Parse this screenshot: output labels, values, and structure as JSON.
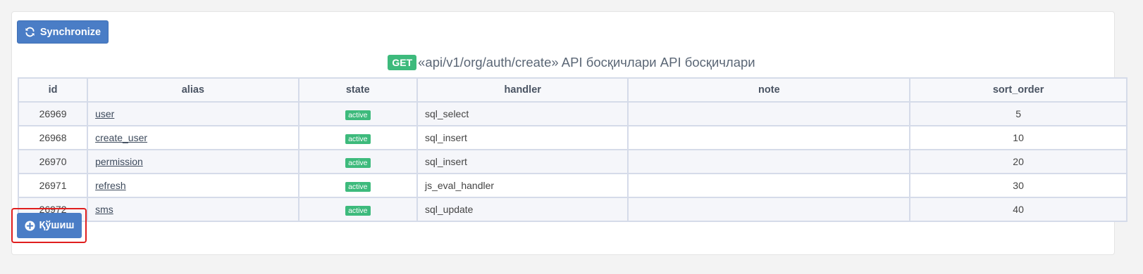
{
  "toolbar": {
    "sync_label": "Synchronize",
    "sync_icon": "refresh-icon"
  },
  "header": {
    "method_badge": "GET",
    "title": "«api/v1/org/auth/create» API босқичлари API босқичлари"
  },
  "table": {
    "columns": [
      "id",
      "alias",
      "state",
      "handler",
      "note",
      "sort_order"
    ],
    "rows": [
      {
        "id": "26969",
        "alias": "user",
        "state": "active",
        "handler": "sql_select",
        "note": "",
        "sort_order": "5"
      },
      {
        "id": "26968",
        "alias": "create_user",
        "state": "active",
        "handler": "sql_insert",
        "note": "",
        "sort_order": "10"
      },
      {
        "id": "26970",
        "alias": "permission",
        "state": "active",
        "handler": "sql_insert",
        "note": "",
        "sort_order": "20"
      },
      {
        "id": "26971",
        "alias": "refresh",
        "state": "active",
        "handler": "js_eval_handler",
        "note": "",
        "sort_order": "30"
      },
      {
        "id": "26972",
        "alias": "sms",
        "state": "active",
        "handler": "sql_update",
        "note": "",
        "sort_order": "40"
      }
    ]
  },
  "footer": {
    "add_label": "Қўшиш",
    "add_icon": "plus-circle-icon"
  },
  "colors": {
    "primary": "#4a7dc6",
    "success": "#3dba7c",
    "highlight": "#e01e1e"
  }
}
